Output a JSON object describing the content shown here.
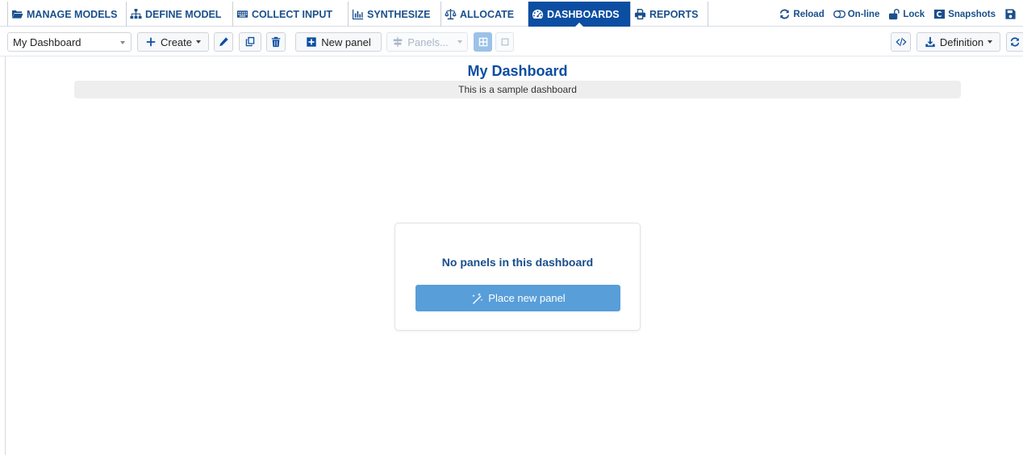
{
  "nav": {
    "tabs": [
      {
        "label": "MANAGE MODELS",
        "icon": "folder-open-icon"
      },
      {
        "label": "DEFINE MODEL",
        "icon": "sitemap-icon"
      },
      {
        "label": "COLLECT INPUT",
        "icon": "keyboard-icon"
      },
      {
        "label": "SYNTHESIZE",
        "icon": "bar-chart-icon"
      },
      {
        "label": "ALLOCATE",
        "icon": "balance-scale-icon"
      },
      {
        "label": "DASHBOARDS",
        "icon": "dashboard-gauge-icon",
        "active": true
      },
      {
        "label": "REPORTS",
        "icon": "printer-icon"
      }
    ],
    "tools": {
      "reload": "Reload",
      "online": "On-line",
      "lock": "Lock",
      "snapshots": "Snapshots"
    }
  },
  "toolbar": {
    "dashboard_select": "My Dashboard",
    "create_label": "Create",
    "new_panel_label": "New panel",
    "panels_label": "Panels...",
    "definition_label": "Definition"
  },
  "dashboard": {
    "title": "My Dashboard",
    "description": "This is a sample dashboard",
    "empty_message": "No panels in this dashboard",
    "place_button": "Place new panel"
  },
  "colors": {
    "brand_blue": "#0b4ea2",
    "nav_text": "#1a4f8b",
    "place_button": "#589ed9",
    "description_bg": "#eeeeee"
  }
}
